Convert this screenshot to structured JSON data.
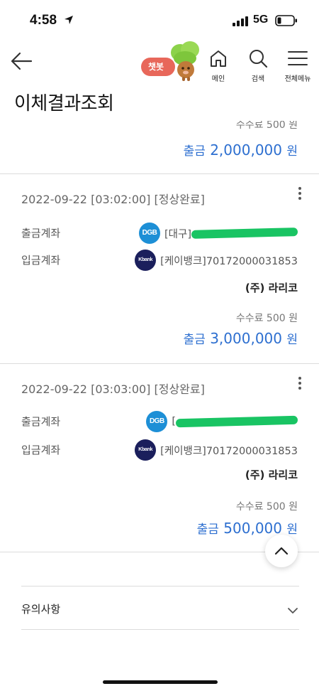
{
  "status_bar": {
    "time": "4:58",
    "network": "5G"
  },
  "header": {
    "chatbot_label": "챗봇",
    "nav": [
      {
        "label": "메인",
        "icon": "home-icon"
      },
      {
        "label": "검색",
        "icon": "search-icon"
      },
      {
        "label": "전체메뉴",
        "icon": "menu-icon"
      }
    ]
  },
  "page_title": "이체결과조회",
  "previous_item": {
    "fee_text": "수수료 500 원",
    "amount_label": "출금",
    "amount_value": "2,000,000",
    "amount_unit": "원"
  },
  "transactions": [
    {
      "datetime": "2022-09-22 [03:02:00] [정상완료]",
      "withdraw_label": "출금계좌",
      "withdraw_bank_logo": "DGB",
      "withdraw_account": "[대구]",
      "deposit_label": "입금계좌",
      "deposit_bank_logo": "Kbank",
      "deposit_account": "[케이뱅크]70172000031853",
      "recipient": "(주) 라리코",
      "fee": "수수료 500 원",
      "amount_label": "출금",
      "amount_value": "3,000,000",
      "amount_unit": "원"
    },
    {
      "datetime": "2022-09-22 [03:03:00] [정상완료]",
      "withdraw_label": "출금계좌",
      "withdraw_bank_logo": "DGB",
      "withdraw_account": "[",
      "deposit_label": "입금계좌",
      "deposit_bank_logo": "Kbank",
      "deposit_account": "[케이뱅크]70172000031853",
      "recipient": "(주) 라리코",
      "fee": "수수료 500 원",
      "amount_label": "출금",
      "amount_value": "500,000",
      "amount_unit": "원"
    }
  ],
  "notice": {
    "label": "유의사항"
  },
  "colors": {
    "accent_blue": "#2d6fd0",
    "chatbot_red": "#e8675a",
    "redaction_green": "#19c463"
  }
}
